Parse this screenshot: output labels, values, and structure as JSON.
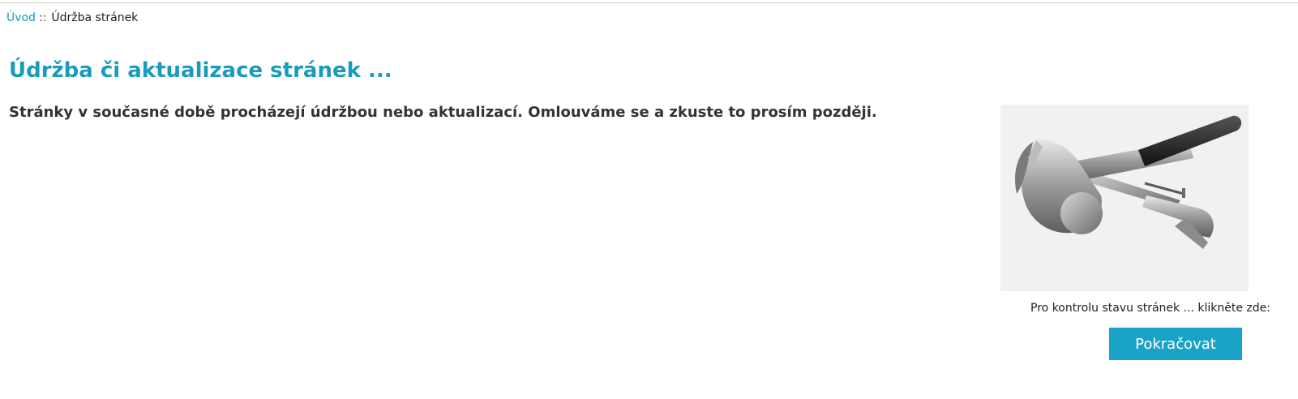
{
  "breadcrumb": {
    "home": "Úvod",
    "separator": "::",
    "current": "Údržba stránek"
  },
  "main": {
    "title": "Údržba či aktualizace stránek ...",
    "message": "Stránky v současné době procházejí údržbou nebo aktualizací. Omlouváme se a zkuste to prosím později."
  },
  "image": {
    "icon": "hammer-and-wrench-image"
  },
  "action": {
    "note": "Pro kontrolu stavu stránek ... klikněte zde:",
    "button_label": "Pokračovat"
  },
  "colors": {
    "accent": "#199bbd",
    "button": "#1ba3c6",
    "text": "#333333"
  }
}
